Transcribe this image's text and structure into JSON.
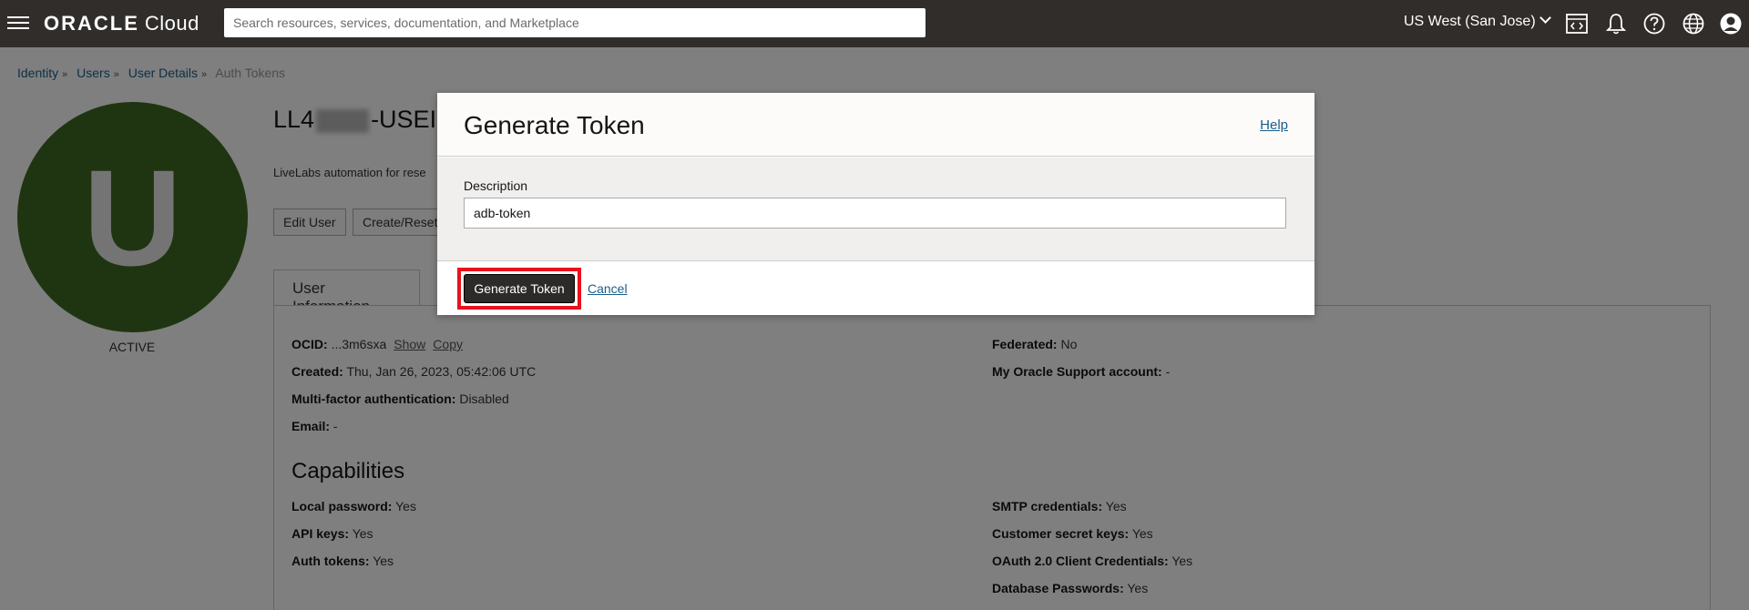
{
  "header": {
    "brand_oracle": "ORACLE",
    "brand_cloud": "Cloud",
    "search_placeholder": "Search resources, services, documentation, and Marketplace",
    "region": "US West (San Jose)",
    "icons": [
      "code-editor-icon",
      "bell-icon",
      "help-icon",
      "globe-icon",
      "profile-icon"
    ]
  },
  "breadcrumb": {
    "items": [
      "Identity",
      "Users",
      "User Details"
    ],
    "current": "Auth Tokens"
  },
  "user": {
    "avatar_letter": "U",
    "status": "ACTIVE",
    "title_prefix": "LL4",
    "title_suffix": "-USEI",
    "description": "LiveLabs automation for rese",
    "buttons": {
      "edit": "Edit User",
      "create_reset": "Create/Reset"
    }
  },
  "tabs": {
    "user_info": "User Information"
  },
  "info": {
    "ocid_label": "OCID:",
    "ocid_value": "...3m6sxa",
    "ocid_show": "Show",
    "ocid_copy": "Copy",
    "created_label": "Created:",
    "created_value": "Thu, Jan 26, 2023, 05:42:06 UTC",
    "mfa_label": "Multi-factor authentication:",
    "mfa_value": "Disabled",
    "email_label": "Email:",
    "email_value": "-",
    "federated_label": "Federated:",
    "federated_value": "No",
    "mos_label": "My Oracle Support account:",
    "mos_value": "-"
  },
  "capabilities": {
    "heading": "Capabilities",
    "local_password_label": "Local password:",
    "local_password_value": "Yes",
    "api_keys_label": "API keys:",
    "api_keys_value": "Yes",
    "auth_tokens_label": "Auth tokens:",
    "auth_tokens_value": "Yes",
    "smtp_label": "SMTP credentials:",
    "smtp_value": "Yes",
    "customer_secret_label": "Customer secret keys:",
    "customer_secret_value": "Yes",
    "oauth_label": "OAuth 2.0 Client Credentials:",
    "oauth_value": "Yes",
    "db_passwords_label": "Database Passwords:",
    "db_passwords_value": "Yes"
  },
  "modal": {
    "title": "Generate Token",
    "help": "Help",
    "description_label": "Description",
    "description_value": "adb-token",
    "primary_button": "Generate Token",
    "cancel": "Cancel",
    "highlight_color": "#e8121b"
  }
}
